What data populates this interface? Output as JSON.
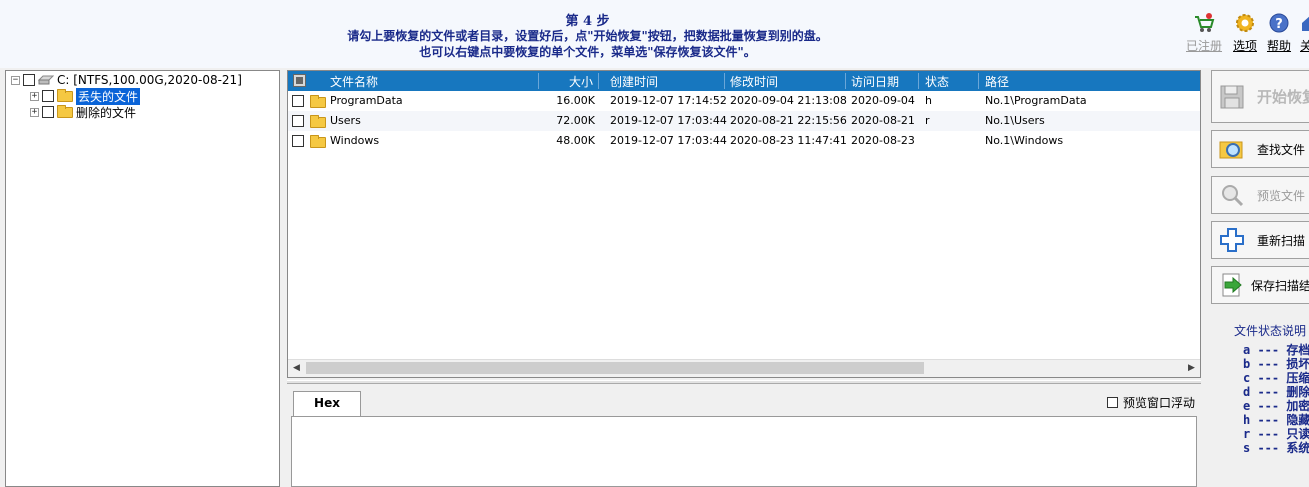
{
  "header": {
    "step": "第 4 步",
    "line1": "请勾上要恢复的文件或者目录，设置好后，点\"开始恢复\"按钮，把数据批量恢复到别的盘。",
    "line2": "也可以右键点中要恢复的单个文件，菜单选\"保存恢复该文件\"。"
  },
  "toolbar": {
    "registered": "已注册",
    "options": "选项",
    "help": "帮助",
    "about": "关"
  },
  "tree": {
    "root": "C:  [NTFS,100.00G,2020-08-21]",
    "items": [
      "丢失的文件",
      "删除的文件"
    ]
  },
  "table": {
    "columns": [
      "文件名称",
      "大小",
      "创建时间",
      "修改时间",
      "访问日期",
      "状态",
      "路径"
    ],
    "rows": [
      {
        "name": "ProgramData",
        "size": "16.00K",
        "created": "2019-12-07 17:14:52",
        "modified": "2020-09-04 21:13:08",
        "accessed": "2020-09-04",
        "status": "h",
        "path": "No.1\\ProgramData"
      },
      {
        "name": "Users",
        "size": "72.00K",
        "created": "2019-12-07 17:03:44",
        "modified": "2020-08-21 22:15:56",
        "accessed": "2020-08-21",
        "status": "r",
        "path": "No.1\\Users"
      },
      {
        "name": "Windows",
        "size": "48.00K",
        "created": "2019-12-07 17:03:44",
        "modified": "2020-08-23 11:47:41",
        "accessed": "2020-08-23",
        "status": "",
        "path": "No.1\\Windows"
      }
    ]
  },
  "hex": {
    "tab": "Hex",
    "float_label": "预览窗口浮动"
  },
  "actions": {
    "start": "开始恢复",
    "find": "查找文件",
    "preview": "预览文件",
    "rescan": "重新扫描",
    "save": "保存扫描结果"
  },
  "legend": {
    "title": "文件状态说明",
    "items": [
      {
        "code": "a",
        "label": "存档"
      },
      {
        "code": "b",
        "label": "损坏"
      },
      {
        "code": "c",
        "label": "压缩"
      },
      {
        "code": "d",
        "label": "删除"
      },
      {
        "code": "e",
        "label": "加密"
      },
      {
        "code": "h",
        "label": "隐藏"
      },
      {
        "code": "r",
        "label": "只读"
      },
      {
        "code": "s",
        "label": "系统"
      }
    ]
  },
  "colors": {
    "header_blue": "#1777bf",
    "selection": "#0a64d8",
    "title_text": "#1a2a8a",
    "folder": "#f5c842"
  }
}
